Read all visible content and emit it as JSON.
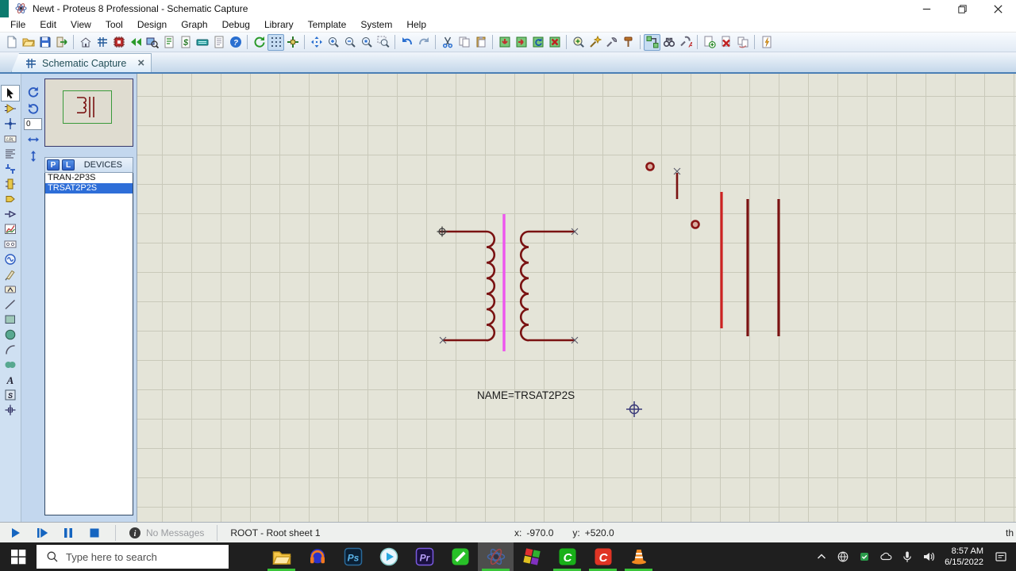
{
  "window": {
    "title": "Newt - Proteus 8 Professional - Schematic Capture"
  },
  "menu": {
    "items": [
      "File",
      "Edit",
      "View",
      "Tool",
      "Design",
      "Graph",
      "Debug",
      "Library",
      "Template",
      "System",
      "Help"
    ]
  },
  "toolbar": {
    "groups": [
      [
        "new-file",
        "open-project",
        "save-project",
        "import-project"
      ],
      [
        "home",
        "schematic-capture",
        "pcb-layout",
        "back-annotate",
        "viewer-3d",
        "bom",
        "design-explorer",
        "gerber-view",
        "project-notes",
        "help"
      ],
      [
        "redraw",
        "toggle-grid",
        "origin"
      ],
      [
        "pan",
        "zoom-in",
        "zoom-out",
        "zoom-extents",
        "zoom-area"
      ],
      [
        "undo",
        "redo"
      ],
      [
        "cut",
        "copy",
        "paste"
      ],
      [
        "block-copy",
        "block-move",
        "block-rotate",
        "block-delete"
      ],
      [
        "pick-parts",
        "make-device",
        "packaging-tool",
        "decompose"
      ],
      [
        "wire-autorouter",
        "search-tag",
        "property-assignment"
      ],
      [
        "new-sheet",
        "remove-sheet",
        "goto-sheet"
      ],
      [
        "erc"
      ]
    ],
    "pressed": [
      "toggle-grid",
      "wire-autorouter"
    ]
  },
  "tab": {
    "label": "Schematic Capture",
    "close_glyph": "×"
  },
  "sidebar": {
    "tools": [
      "selection",
      "component",
      "junction-dot",
      "wire-label",
      "text-script",
      "bus",
      "subcircuit",
      "terminal",
      "device-pin",
      "graph",
      "tape-recorder",
      "generator",
      "voltage-probe",
      "current-probe",
      "line-2d",
      "box-2d",
      "circle-2d",
      "arc-2d",
      "path-2d",
      "text-2d",
      "symbol-2d",
      "marker-2d"
    ],
    "active_tool": "selection",
    "rotation_value": "0"
  },
  "devices": {
    "p_button": "P",
    "l_button": "L",
    "header": "DEVICES",
    "items": [
      {
        "name": "TRAN-2P3S",
        "selected": false
      },
      {
        "name": "TRSAT2P2S",
        "selected": true
      }
    ]
  },
  "canvas": {
    "component_label": "NAME=TRSAT2P2S",
    "colors": {
      "coil": "#7a1212",
      "core_line": "#ee55ee",
      "highlight_line": "#cc2222",
      "background": "#e4e4d8",
      "grid": "#c9c9ba"
    }
  },
  "simulation": {
    "controls": [
      "play",
      "step",
      "pause",
      "stop"
    ]
  },
  "status": {
    "messages": "No Messages",
    "sheet": "ROOT - Root sheet 1",
    "x_label": "x:",
    "x_value": "-970.0",
    "y_label": "y:",
    "y_value": "+520.0",
    "units": "th"
  },
  "taskbar": {
    "search_placeholder": "Type here to search",
    "apps": [
      "file-explorer",
      "audacity",
      "photoshop",
      "potplayer",
      "premiere",
      "line-app",
      "proteus",
      "mixcraft",
      "camtasia",
      "clipchamp",
      "vlc"
    ],
    "active_app": "proteus",
    "running_apps": [
      "file-explorer",
      "proteus",
      "camtasia",
      "clipchamp",
      "vlc"
    ],
    "tray": [
      "tray-chevron",
      "network-globe",
      "antivirus-shield",
      "onedrive-cloud",
      "microphone",
      "volume"
    ],
    "clock": {
      "time": "8:57 AM",
      "date": "6/15/2022"
    }
  }
}
